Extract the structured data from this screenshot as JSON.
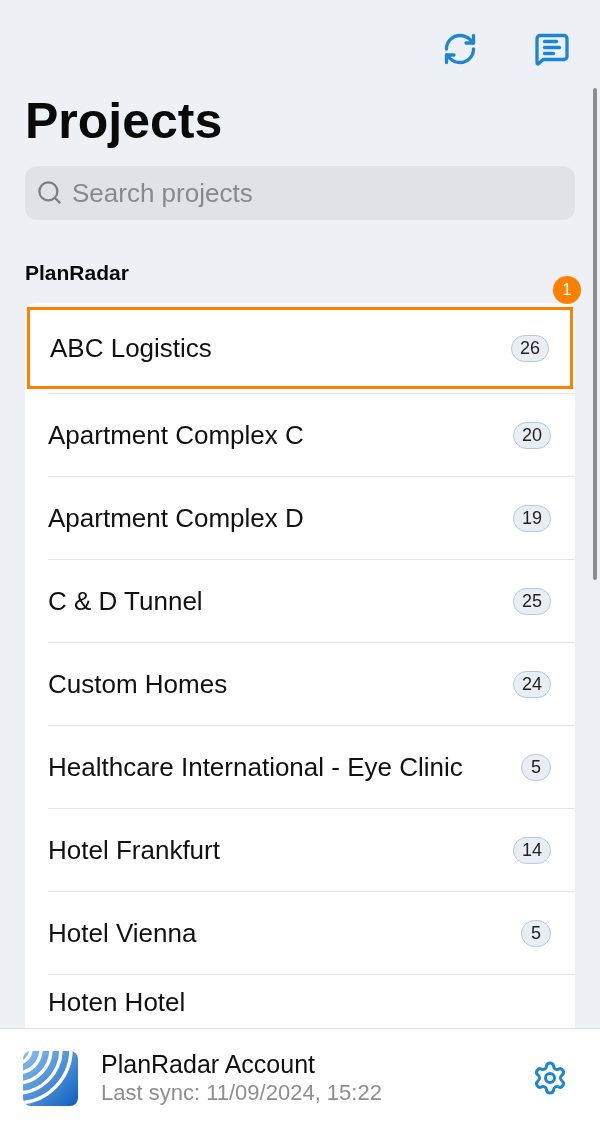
{
  "title": "Projects",
  "search": {
    "placeholder": "Search projects"
  },
  "group": {
    "label": "PlanRadar",
    "projects": [
      {
        "name": "ABC Logistics",
        "count": "26",
        "highlighted": true,
        "marker": "1"
      },
      {
        "name": "Apartment Complex C",
        "count": "20",
        "highlighted": false
      },
      {
        "name": "Apartment Complex D",
        "count": "19",
        "highlighted": false
      },
      {
        "name": "C & D Tunnel",
        "count": "25",
        "highlighted": false
      },
      {
        "name": "Custom Homes",
        "count": "24",
        "highlighted": false
      },
      {
        "name": "Healthcare International - Eye Clinic",
        "count": "5",
        "highlighted": false
      },
      {
        "name": "Hotel Frankfurt",
        "count": "14",
        "highlighted": false
      },
      {
        "name": "Hotel Vienna",
        "count": "5",
        "highlighted": false
      },
      {
        "name": "Hoten Hotel",
        "highlighted": false
      }
    ]
  },
  "footer": {
    "account": "PlanRadar Account",
    "last_sync": "Last sync: 11/09/2024, 15:22"
  }
}
